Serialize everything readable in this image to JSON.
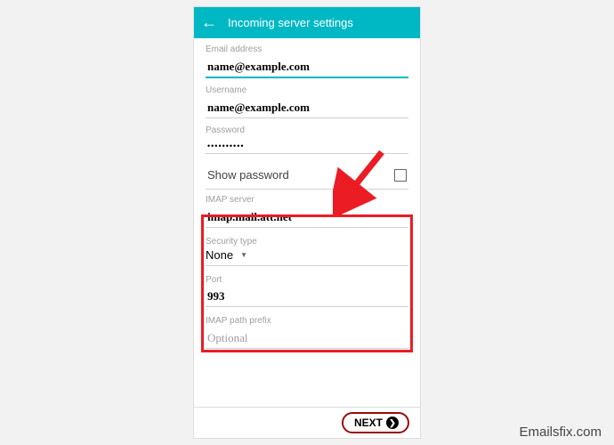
{
  "header": {
    "title": "Incoming server settings"
  },
  "fields": {
    "email_label": "Email address",
    "email_value": "name@example.com",
    "username_label": "Username",
    "username_value": "name@example.com",
    "password_label": "Password",
    "password_value": "••••••••••",
    "show_password": "Show password",
    "imap_server_label": "IMAP server",
    "imap_server_value": "imap.mail.att.net",
    "security_label": "Security type",
    "security_value": "None",
    "port_label": "Port",
    "port_value": "993",
    "path_prefix_label": "IMAP path prefix",
    "path_prefix_placeholder": "Optional"
  },
  "footer": {
    "next_label": "NEXT"
  },
  "watermark": "Emailsfix.com"
}
